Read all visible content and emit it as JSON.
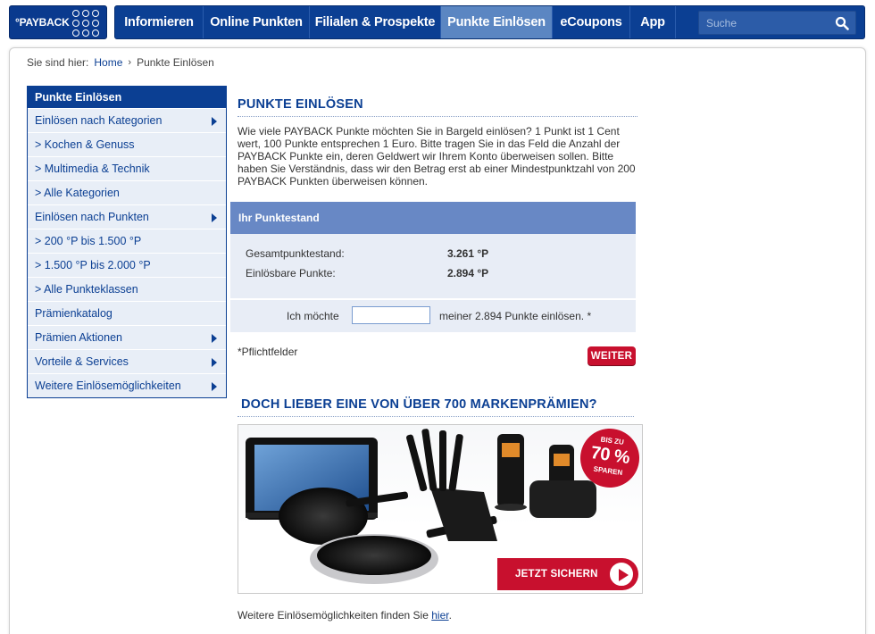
{
  "header": {
    "logo_text": "°PAYBACK",
    "nav": [
      {
        "label": "Informieren",
        "active": false
      },
      {
        "label": "Online Punkten",
        "active": false
      },
      {
        "label": "Filialen & Prospekte",
        "active": false
      },
      {
        "label": "Punkte Einlösen",
        "active": true
      },
      {
        "label": "eCoupons",
        "active": false
      },
      {
        "label": "App",
        "active": false
      }
    ],
    "search_placeholder": "Suche"
  },
  "breadcrumb": {
    "prefix": "Sie sind hier:",
    "home": "Home",
    "current": "Punkte Einlösen"
  },
  "sidebar": {
    "title": "Punkte Einlösen",
    "items": [
      {
        "label": "Einlösen nach Kategorien",
        "arrow": true
      },
      {
        "label": "> Kochen & Genuss",
        "arrow": false
      },
      {
        "label": "> Multimedia & Technik",
        "arrow": false
      },
      {
        "label": "> Alle Kategorien",
        "arrow": false
      },
      {
        "label": "Einlösen nach Punkten",
        "arrow": true
      },
      {
        "label": "> 200 °P bis 1.500 °P",
        "arrow": false
      },
      {
        "label": "> 1.500 °P bis 2.000 °P",
        "arrow": false
      },
      {
        "label": "> Alle Punkteklassen",
        "arrow": false
      },
      {
        "label": "Prämienkatalog",
        "arrow": false
      },
      {
        "label": "Prämien Aktionen",
        "arrow": true
      },
      {
        "label": "Vorteile & Services",
        "arrow": true
      },
      {
        "label": "Weitere Einlösemöglichkeiten",
        "arrow": true
      }
    ]
  },
  "main": {
    "title": "PUNKTE EINLÖSEN",
    "intro": "Wie viele PAYBACK Punkte möchten Sie in Bargeld einlösen? 1 Punkt ist 1 Cent wert, 100 Punkte entsprechen 1 Euro. Bitte tragen Sie in das Feld die Anzahl der PAYBACK Punkte ein, deren Geldwert wir Ihrem Konto überweisen sollen. Bitte haben Sie Verständnis, dass wir den Betrag erst ab einer Mindestpunktzahl von 200 PAYBACK Punkten überweisen können.",
    "box_title": "Ihr Punktestand",
    "total_label": "Gesamtpunktestand:",
    "total_value": "3.261  °P",
    "redeemable_label": "Einlösbare Punkte:",
    "redeemable_value": "2.894 °P",
    "row_prefix": "Ich möchte",
    "amount_value": "",
    "row_middle": "meiner  2.894  Punkte einlösen. *",
    "required": "*Pflichtfelder",
    "submit": "WEITER",
    "promo_title": "DOCH LIEBER EINE VON ÜBER 700 MARKENPRÄMIEN?",
    "banner_badge_top": "BIS ZU",
    "banner_badge_value": "70 %",
    "banner_badge_bottom": "SPAREN",
    "banner_cta": "JETZT SICHERN",
    "footer_text": "Weitere Einlösemöglichkeiten finden Sie ",
    "footer_link": "hier",
    "footer_end": "."
  },
  "colors": {
    "brand_blue": "#0b3f93",
    "active_tab": "#5b86c2",
    "accent_red": "#c8102e",
    "panel_bg": "#e8edf6"
  }
}
